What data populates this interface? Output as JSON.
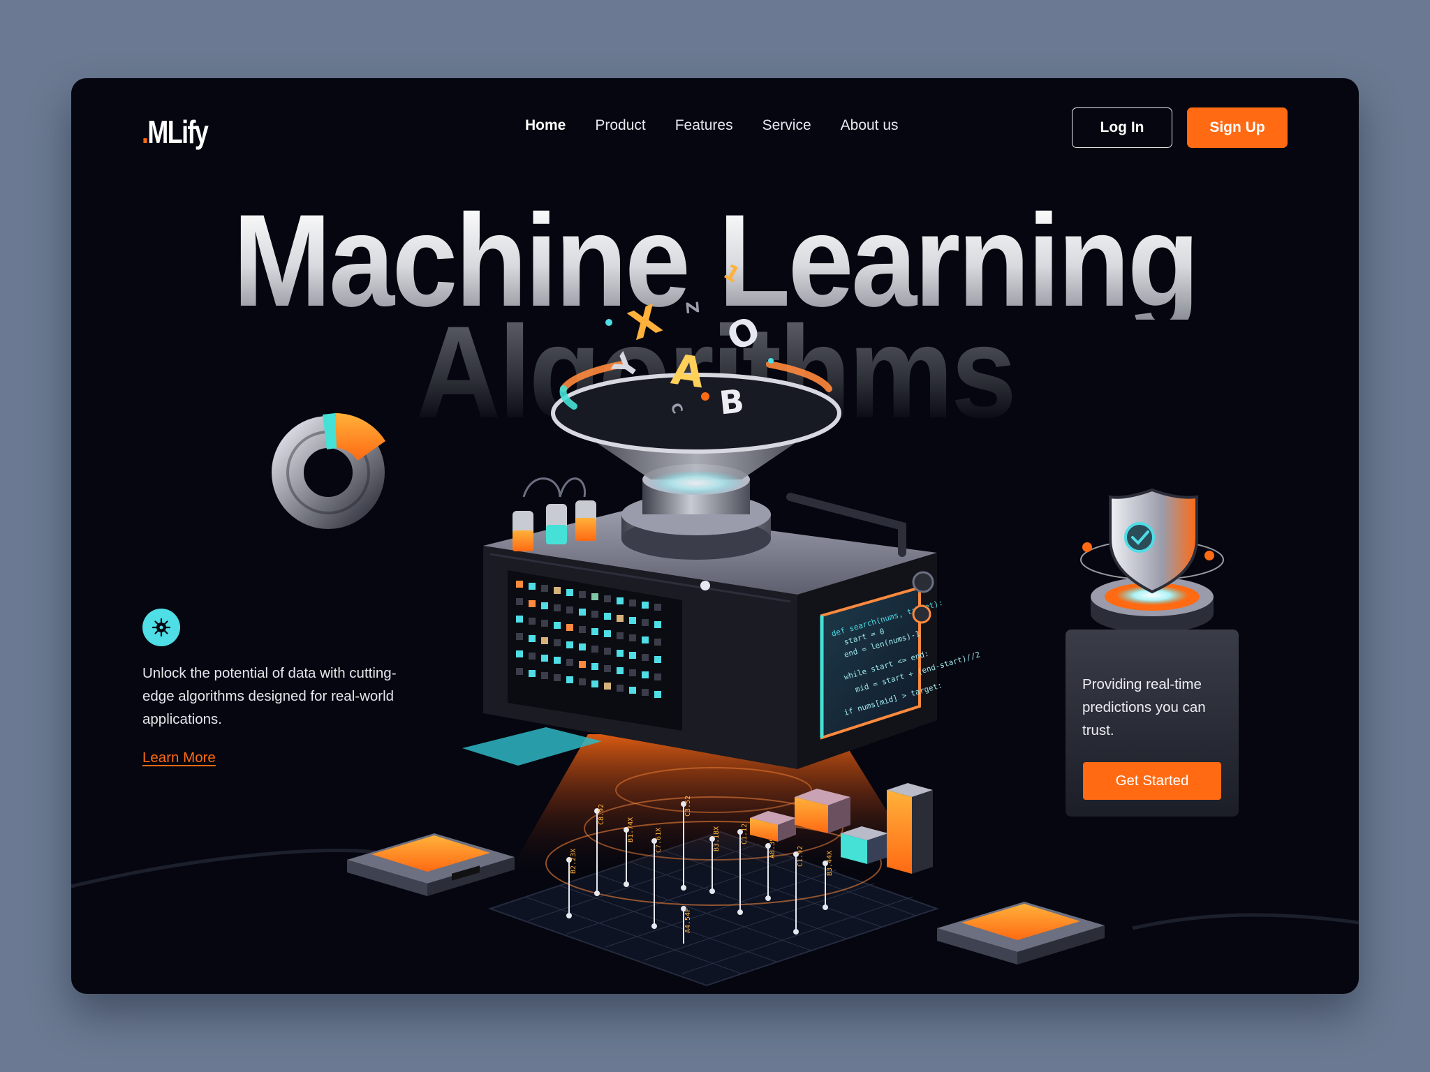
{
  "brand": {
    "dot": ".",
    "name": "MLify"
  },
  "nav": {
    "items": [
      {
        "label": "Home",
        "active": true
      },
      {
        "label": "Product",
        "active": false
      },
      {
        "label": "Features",
        "active": false
      },
      {
        "label": "Service",
        "active": false
      },
      {
        "label": "About us",
        "active": false
      }
    ]
  },
  "auth": {
    "login_label": "Log In",
    "signup_label": "Sign Up"
  },
  "hero": {
    "title_line1": "Machine Learning",
    "title_line2": "Algorithms"
  },
  "feature": {
    "icon": "neural-network-icon",
    "description": "Unlock the potential of data with cutting-edge algorithms designed for real-world applications.",
    "link_label": "Learn More"
  },
  "card": {
    "icon": "shield-check-icon",
    "text": "Providing real-time predictions you can trust.",
    "button_label": "Get Started"
  },
  "illustration": {
    "letters": [
      "X",
      "A",
      "O",
      "B",
      "Y",
      "Z",
      "1",
      "C"
    ],
    "code_lines": [
      "def search(nums, target):",
      "start = 0",
      "end = len(nums)-1",
      "while start <= end:",
      "mid = start + (end-start)//2",
      "if nums[mid] > target:"
    ],
    "data_labels": [
      "B2.23X",
      "C8.92",
      "B1.74X",
      "C7.61X",
      "A4.54F",
      "C3.52",
      "B3.18X",
      "C1.12",
      "A8.39F",
      "C1.92",
      "B3.44X"
    ]
  },
  "colors": {
    "accent": "#ff6a13",
    "teal": "#4fdde6",
    "background": "#05060f",
    "page_bg": "#6b7a92"
  }
}
